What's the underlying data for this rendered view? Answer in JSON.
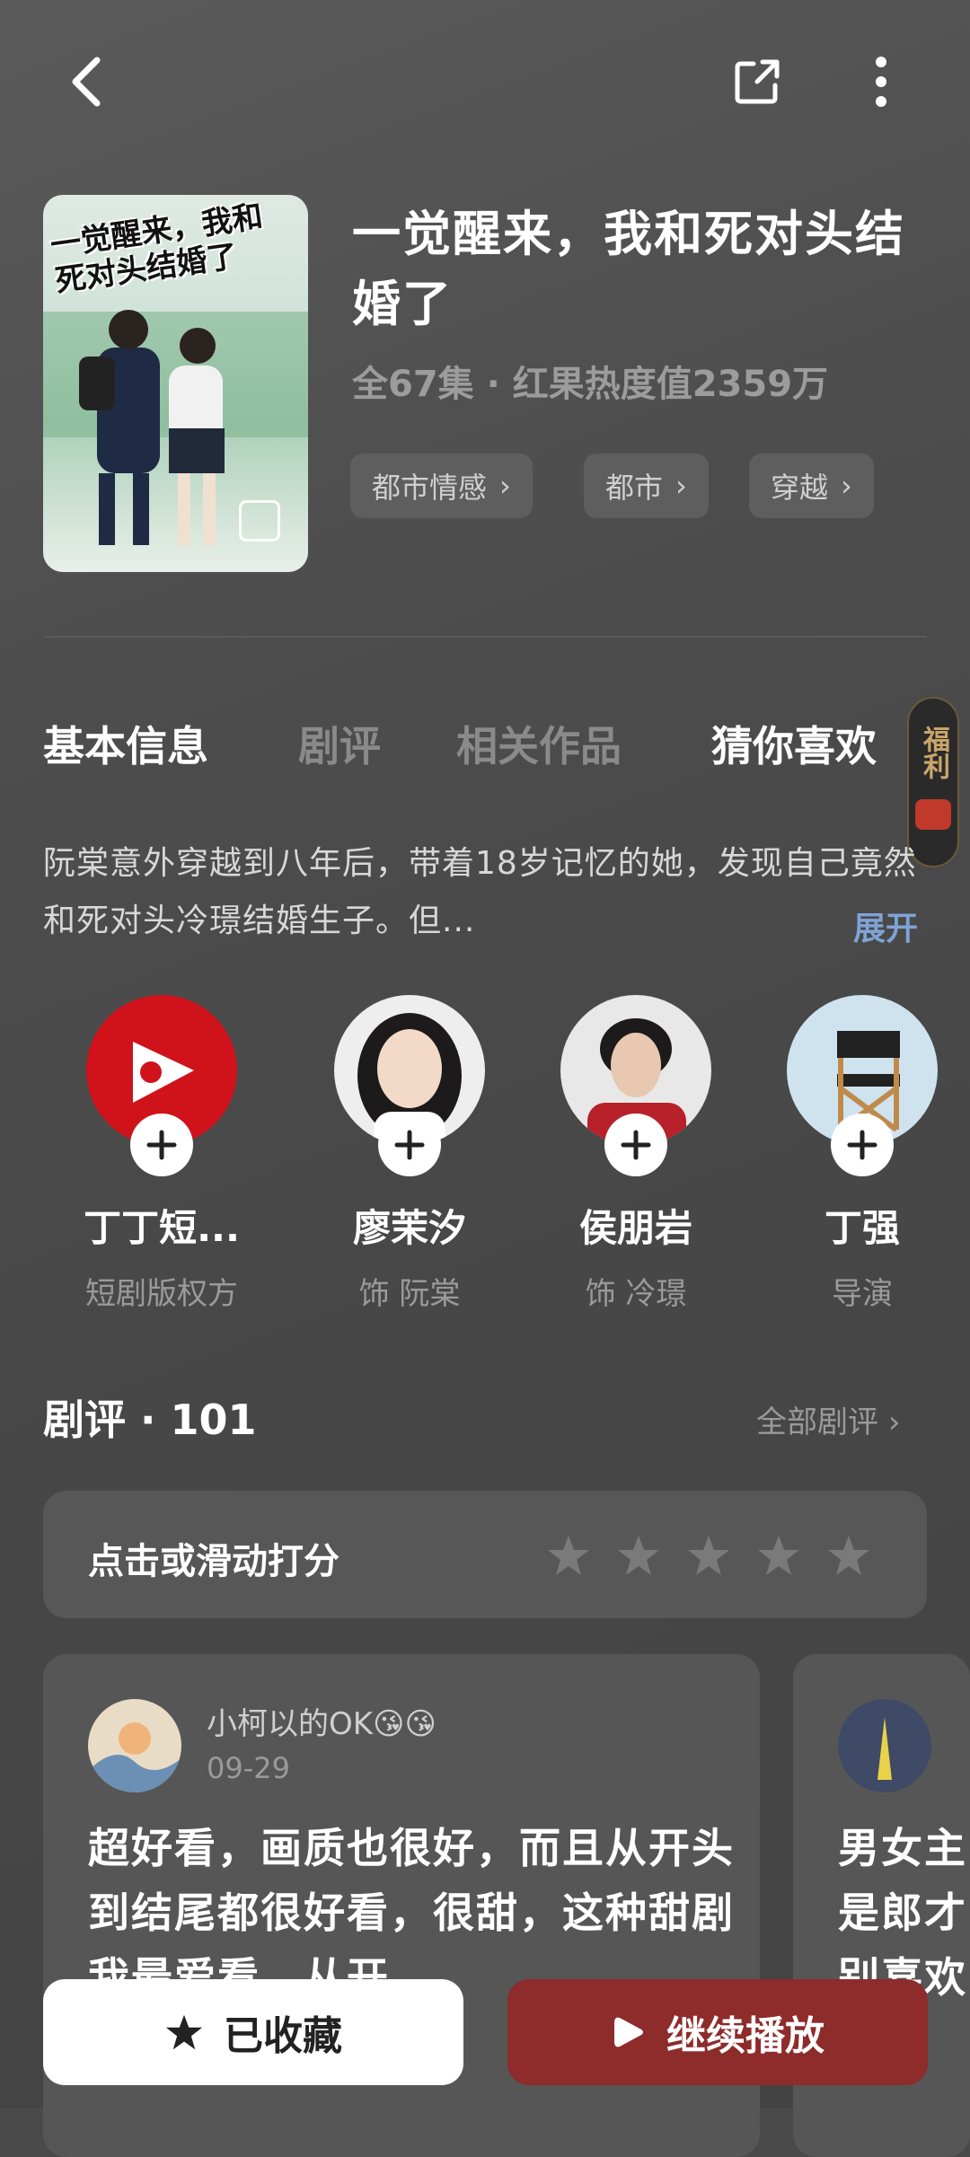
{
  "drama": {
    "poster_text": "一觉醒来，我和死对头结婚了",
    "title": "一觉醒来，我和死对头结婚了",
    "meta": "全67集 · 红果热度值2359万",
    "tags": [
      "都市情感",
      "都市",
      "穿越"
    ]
  },
  "tabs": [
    "基本信息",
    "剧评",
    "相关作品",
    "猜你喜欢"
  ],
  "side_badge": {
    "label": "福利"
  },
  "description": {
    "text": "阮棠意外穿越到八年后，带着18岁记忆的她，发现自己竟然和死对头冷璟结婚生子。但...",
    "expand_label": "展开"
  },
  "cast": [
    {
      "name": "丁丁短...",
      "role": "短剧版权方"
    },
    {
      "name": "廖茉汐",
      "role": "饰 阮棠"
    },
    {
      "name": "侯朋岩",
      "role": "饰 冷璟"
    },
    {
      "name": "丁强",
      "role": "导演"
    }
  ],
  "reviews_section": {
    "title": "剧评 · 101",
    "all_label": "全部剧评",
    "rate_prompt": "点击或滑动打分",
    "rating": {
      "value": 0,
      "max": 5
    }
  },
  "reviews": [
    {
      "user": "小柯以的OK😘😘",
      "date": "09-29",
      "text": "超好看，画质也很好，而且从开头到结尾都很好看，很甜，这种甜剧我最爱看，从开"
    },
    {
      "user": "",
      "date": "",
      "text": "男女主是郎才别喜欢"
    }
  ],
  "bottom_bar": {
    "fav_label": "已收藏",
    "play_label": "继续播放"
  },
  "colors": {
    "background": "#4a4a4a",
    "play_button": "#8e2b2b",
    "expand": "#7fa3d6"
  }
}
